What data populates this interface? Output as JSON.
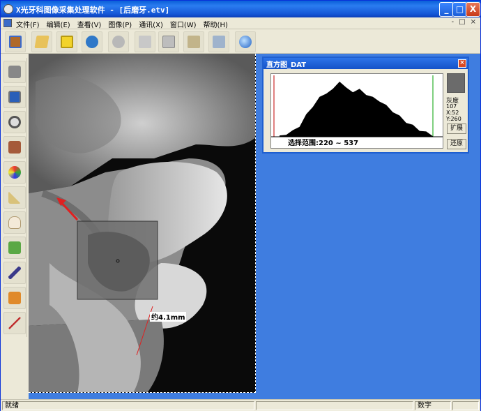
{
  "window": {
    "title": "X光牙科图像采集处理软件 - [后磨牙.etv]",
    "min_label": "_",
    "max_label": "□",
    "close_label": "X"
  },
  "menu": {
    "items": [
      "文件(F)",
      "编辑(E)",
      "查看(V)",
      "图像(P)",
      "通讯(X)",
      "窗口(W)",
      "帮助(H)"
    ],
    "mdi_controls": [
      "-",
      "□",
      "×"
    ]
  },
  "toolbar": {
    "icons": [
      "book-icon",
      "open-folder-icon",
      "save-disk-icon",
      "back-circle-icon",
      "forward-circle-icon",
      "scissors-icon",
      "copy-icon",
      "paste-icon",
      "printer-icon",
      "globe-icon"
    ]
  },
  "left_tools": {
    "icons": [
      "camera-icon",
      "monitor-icon",
      "magnifier-icon",
      "texture-icon",
      "palette-icon",
      "ruler-triangle-icon",
      "tooth-icon",
      "brush-icon",
      "pen-icon",
      "tools-icon",
      "measure-line-icon"
    ]
  },
  "image": {
    "measurement_label": "约4.1mm"
  },
  "histogram": {
    "title": "直方图_DAT",
    "close_label": "×",
    "range_label": "选择范围:220 ~ 537",
    "gray_label": "灰度",
    "gray_value": "107",
    "x_label": "X:52",
    "y_label": "Y:260",
    "expand_label": "扩展",
    "restore_label": "还原",
    "swatch_color": "#6b6b6b"
  },
  "chart_data": {
    "type": "area",
    "x": [
      0,
      10,
      20,
      30,
      40,
      50,
      60,
      70,
      80,
      90,
      100,
      110,
      120,
      130,
      140,
      150,
      160,
      170,
      180,
      190,
      200,
      210,
      220,
      230
    ],
    "values": [
      2,
      6,
      10,
      18,
      34,
      48,
      60,
      68,
      72,
      86,
      74,
      70,
      72,
      66,
      60,
      56,
      48,
      40,
      32,
      24,
      18,
      12,
      8,
      4
    ],
    "selection": [
      220,
      537
    ]
  },
  "status": {
    "ready": "就绪",
    "mode": "数字"
  }
}
